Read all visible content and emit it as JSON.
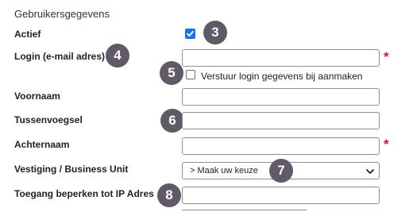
{
  "form": {
    "section_title": "Gebruikersgegevens",
    "actief": {
      "label": "Actief",
      "checked": true
    },
    "login": {
      "label": "Login (e-mail adres)",
      "value": "",
      "required_mark": "*"
    },
    "send_login": {
      "label": "Verstuur login gegevens bij aanmaken",
      "checked": false
    },
    "voornaam": {
      "label": "Voornaam",
      "value": ""
    },
    "tussenvoegsel": {
      "label": "Tussenvoegsel",
      "value": ""
    },
    "achternaam": {
      "label": "Achternaam",
      "value": "",
      "required_mark": "*"
    },
    "vestiging": {
      "label": "Vestiging / Business Unit",
      "selected": "> Maak uw keuze"
    },
    "ip": {
      "label": "Toegang beperken tot IP Adres",
      "value": ""
    }
  },
  "badges": [
    "3",
    "4",
    "5",
    "6",
    "7",
    "8"
  ],
  "colors": {
    "checkbox_accent": "#1a73e8",
    "required": "#d9152d",
    "badge_bg": "#5f5a66"
  },
  "icons": {
    "check": "checkmark-icon",
    "select": "chevron-down-icon"
  }
}
